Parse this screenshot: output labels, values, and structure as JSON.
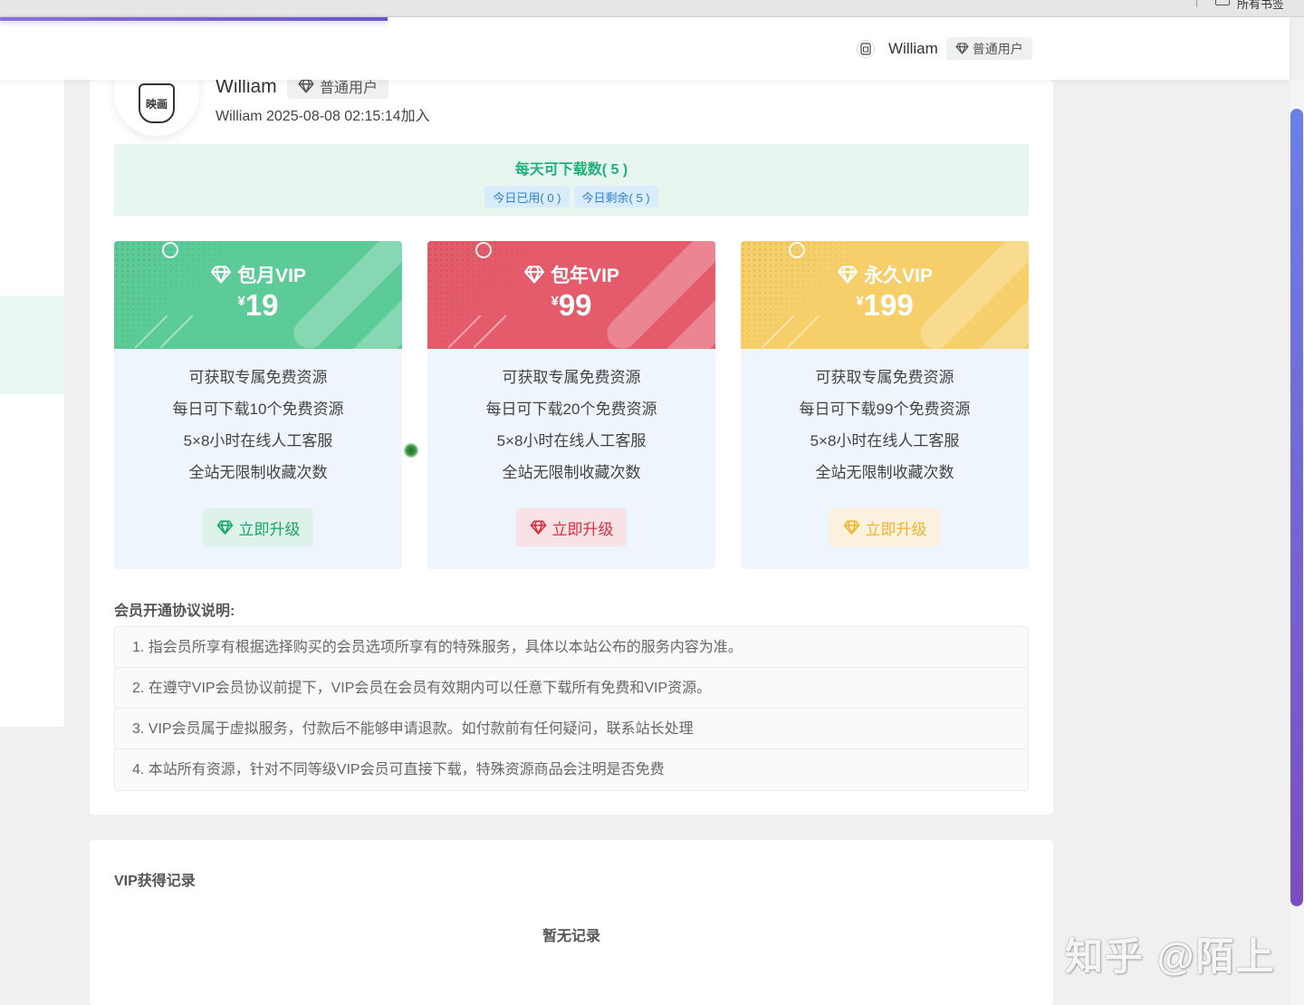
{
  "browser": {
    "bookmark_label": "所有书签"
  },
  "header": {
    "user_name": "William",
    "user_badge": "普通用户"
  },
  "profile": {
    "avatar_text": "映画",
    "name": "William",
    "badge": "普通用户",
    "joined": "William 2025-08-08 02:15:14加入"
  },
  "daily": {
    "title": "每天可下载数( 5 )",
    "used": "今日已用( 0 )",
    "remaining": "今日剩余( 5 )"
  },
  "plans": [
    {
      "name": "包月VIP",
      "currency": "¥",
      "price": "19",
      "color": "#5ccb98",
      "features": [
        "可获取专属免费资源",
        "每日可下载10个免费资源",
        "5×8小时在线人工客服",
        "全站无限制收藏次数"
      ],
      "button": "立即升级",
      "button_bg": "#ddf3ea",
      "button_color": "#1aa36b"
    },
    {
      "name": "包年VIP",
      "currency": "¥",
      "price": "99",
      "color": "#e45c6c",
      "features": [
        "可获取专属免费资源",
        "每日可下载20个免费资源",
        "5×8小时在线人工客服",
        "全站无限制收藏次数"
      ],
      "button": "立即升级",
      "button_bg": "#f9e2e6",
      "button_color": "#d9303f"
    },
    {
      "name": "永久VIP",
      "currency": "¥",
      "price": "199",
      "color": "#f6cf6a",
      "features": [
        "可获取专属免费资源",
        "每日可下载99个免费资源",
        "5×8小时在线人工客服",
        "全站无限制收藏次数"
      ],
      "button": "立即升级",
      "button_bg": "#fbf1dc",
      "button_color": "#f0b52e"
    }
  ],
  "agreement": {
    "title": "会员开通协议说明:",
    "items": [
      "1. 指会员所享有根据选择购买的会员选项所享有的特殊服务，具体以本站公布的服务内容为准。",
      "2. 在遵守VIP会员协议前提下，VIP会员在会员有效期内可以任意下载所有免费和VIP资源。",
      "3. VIP会员属于虚拟服务，付款后不能够申请退款。如付款前有任何疑问，联系站长处理",
      "4. 本站所有资源，针对不同等级VIP会员可直接下载，特殊资源商品会注明是否免费"
    ]
  },
  "records": {
    "title": "VIP获得记录",
    "empty": "暂无记录"
  },
  "watermark": "知乎 @陌上"
}
